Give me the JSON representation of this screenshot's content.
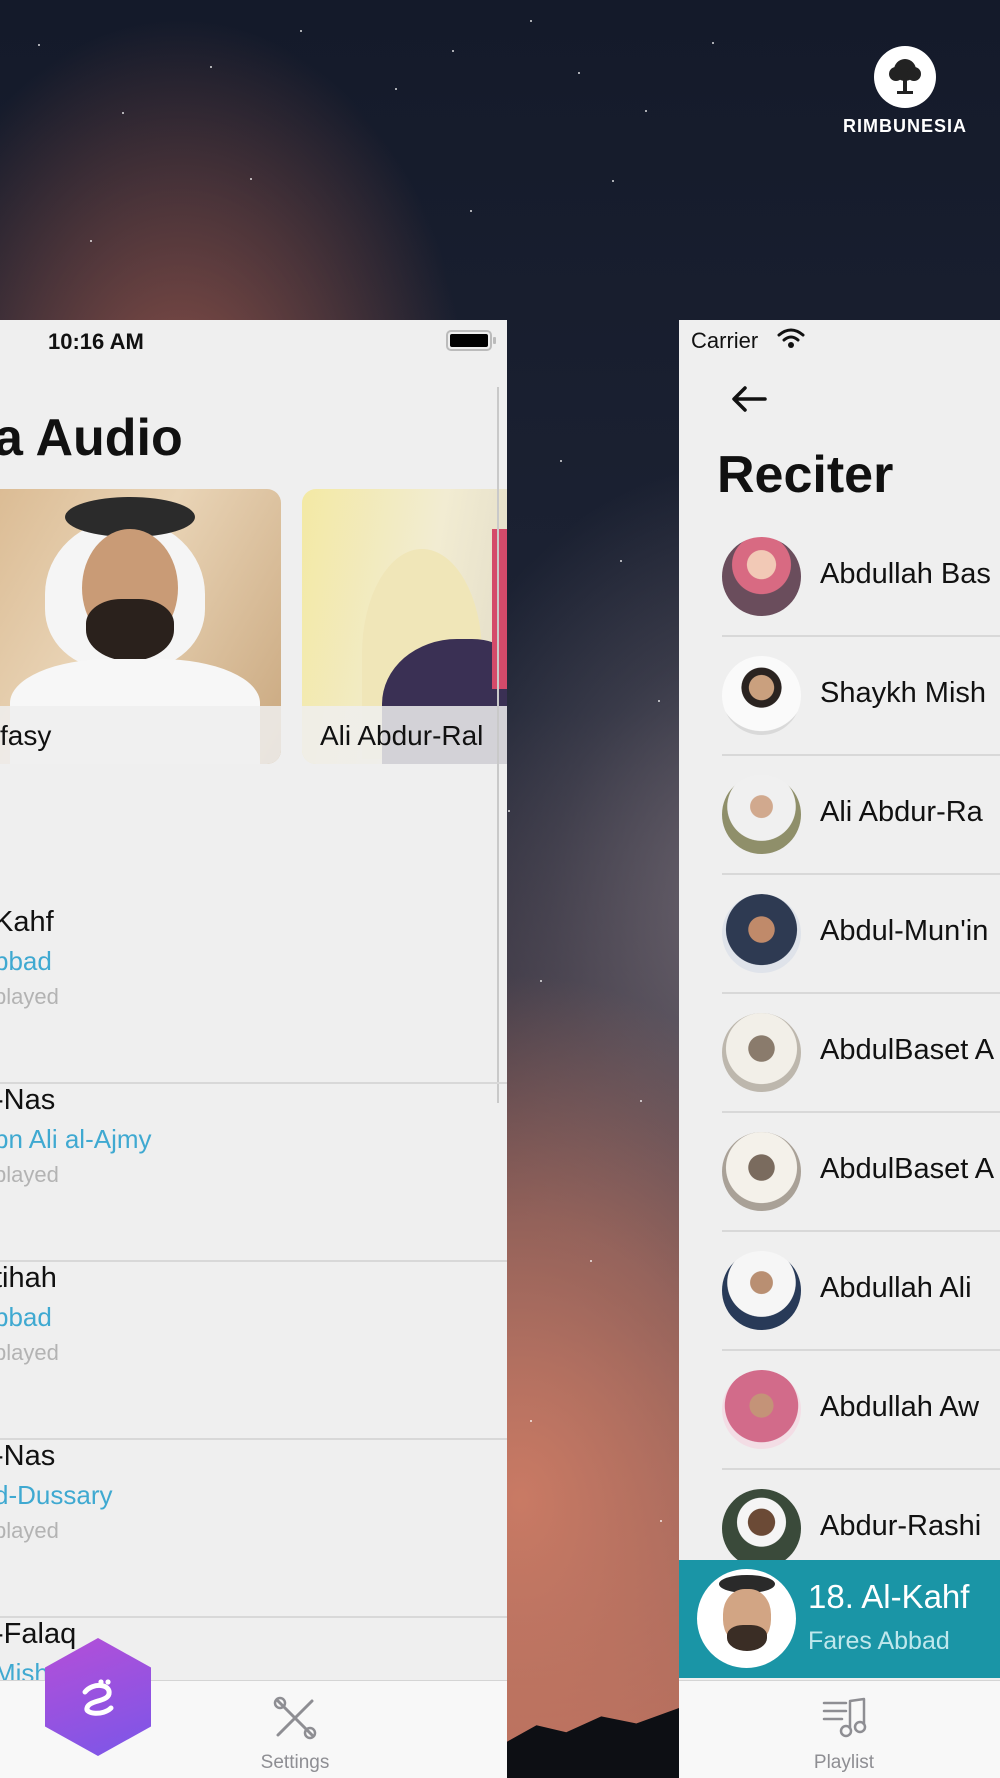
{
  "brand": {
    "name": "RIMBUNESIA",
    "icon": "tree-icon"
  },
  "left_screen": {
    "status_time": "10:16 AM",
    "page_title": "a Audio",
    "featured_reciters": [
      {
        "name": "fasy"
      },
      {
        "name": "Ali Abdur-Ral"
      }
    ],
    "recent_tracks": [
      {
        "title": "Kahf",
        "artist": "bbad",
        "status": "played"
      },
      {
        "title": "-Nas",
        "artist": "bn Ali al-Ajmy",
        "status": "played"
      },
      {
        "title": "tihah",
        "artist": "bbad",
        "status": "played"
      },
      {
        "title": "-Nas",
        "artist": "d-Dussary",
        "status": "played"
      },
      {
        "title": "-Falaq",
        "artist": "Mish      asy",
        "status": ""
      }
    ],
    "tabbar": {
      "settings_label": "Settings"
    }
  },
  "right_screen": {
    "carrier": "Carrier",
    "title": "Reciter",
    "reciters": [
      {
        "name": "Abdullah Bas"
      },
      {
        "name": "Shaykh Mish"
      },
      {
        "name": "Ali Abdur-Ra"
      },
      {
        "name": "Abdul-Mun'in"
      },
      {
        "name": "AbdulBaset A"
      },
      {
        "name": "AbdulBaset A"
      },
      {
        "name": "Abdullah Ali"
      },
      {
        "name": "Abdullah Aw"
      },
      {
        "name": "Abdur-Rashi"
      }
    ],
    "now_playing": {
      "title": "18. Al-Kahf",
      "artist": "Fares Abbad"
    },
    "tabbar": {
      "playlist_label": "Playlist"
    }
  },
  "colors": {
    "accent_link": "#3fa9d1",
    "now_playing_bg": "#1a95a6",
    "fab_gradient_start": "#b44fd8",
    "fab_gradient_end": "#7b56e8"
  }
}
